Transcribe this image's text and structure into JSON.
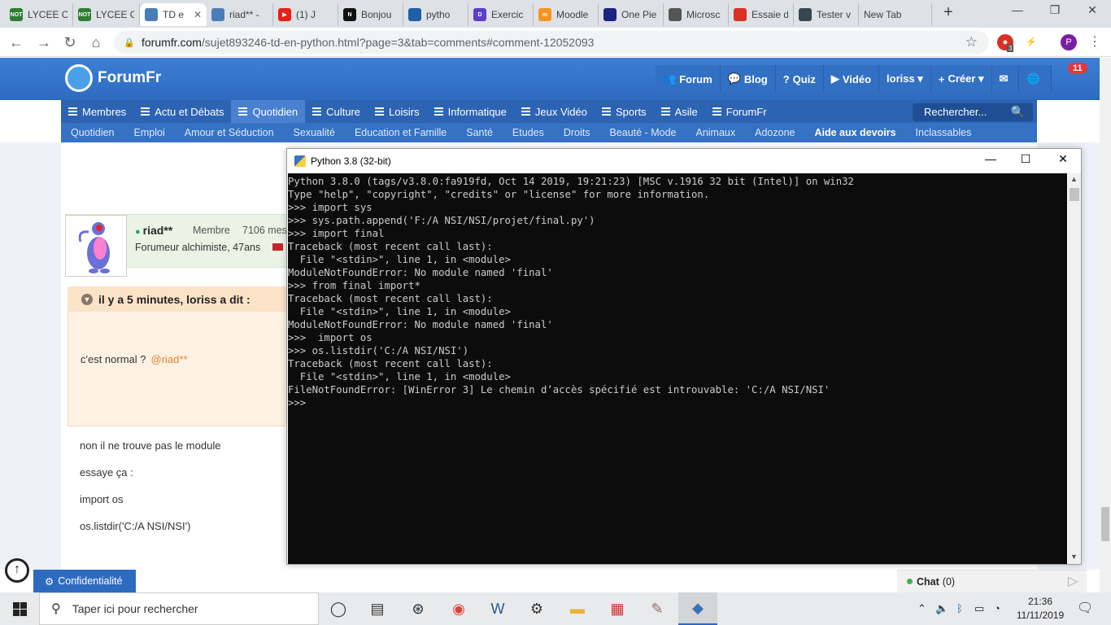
{
  "browser": {
    "tabs": [
      {
        "label": "LYCEE C",
        "color": "#2e7d32",
        "fav": "NOT"
      },
      {
        "label": "LYCEE G",
        "color": "#2e7d32",
        "fav": "NOT"
      },
      {
        "label": "TD e",
        "color": "#4a7db8",
        "fav": "",
        "active": true
      },
      {
        "label": "riad** -",
        "color": "#4a7db8",
        "fav": ""
      },
      {
        "label": "(1) J",
        "color": "#e62117",
        "fav": "▶"
      },
      {
        "label": "Bonjou",
        "color": "#111111",
        "fav": "N"
      },
      {
        "label": "pytho",
        "color": "#1f5fa6",
        "fav": ""
      },
      {
        "label": "Exercic",
        "color": "#5c3fc9",
        "fav": "D"
      },
      {
        "label": "Moodle",
        "color": "#f7931e",
        "fav": "m"
      },
      {
        "label": "One Pie",
        "color": "#1a237e",
        "fav": ""
      },
      {
        "label": "Microsc",
        "color": "#555555",
        "fav": ""
      },
      {
        "label": "Essaie d",
        "color": "#d93025",
        "fav": ""
      },
      {
        "label": "Tester v",
        "color": "#37474f",
        "fav": ""
      },
      {
        "label": "New Tab",
        "color": "",
        "fav": ""
      }
    ],
    "url_host": "forumfr.com",
    "url_path": "/sujet893246-td-en-python.html?page=3&tab=comments#comment-12052093",
    "ext_badge": "3",
    "profile_initial": "P"
  },
  "site": {
    "logo": "ForumFr",
    "topnav": [
      {
        "icon": "👥",
        "label": "Forum"
      },
      {
        "icon": "💬",
        "label": "Blog"
      },
      {
        "icon": "?",
        "label": "Quiz"
      },
      {
        "icon": "▶",
        "label": "Vidéo"
      },
      {
        "icon": "",
        "label": "loriss ▾"
      },
      {
        "icon": "+",
        "label": "Créer ▾"
      },
      {
        "icon": "✉",
        "label": ""
      },
      {
        "icon": "🌐",
        "label": ""
      }
    ],
    "notif_count": "11",
    "categories": [
      {
        "label": "Membres"
      },
      {
        "label": "Actu et Débats"
      },
      {
        "label": "Quotidien",
        "active": true
      },
      {
        "label": "Culture"
      },
      {
        "label": "Loisirs"
      },
      {
        "label": "Informatique"
      },
      {
        "label": "Jeux Vidéo"
      },
      {
        "label": "Sports"
      },
      {
        "label": "Asile"
      },
      {
        "label": "ForumFr"
      }
    ],
    "search_placeholder": "Rechercher...",
    "subcategories": [
      {
        "label": "Quotidien"
      },
      {
        "label": "Emploi"
      },
      {
        "label": "Amour et Séduction"
      },
      {
        "label": "Sexualité"
      },
      {
        "label": "Education et Famille"
      },
      {
        "label": "Santé"
      },
      {
        "label": "Etudes"
      },
      {
        "label": "Droits"
      },
      {
        "label": "Beauté - Mode"
      },
      {
        "label": "Animaux"
      },
      {
        "label": "Adozone"
      },
      {
        "label": "Aide aux devoirs",
        "strong": true
      },
      {
        "label": "Inclassables"
      }
    ]
  },
  "post": {
    "username": "riad**",
    "role": "Membre",
    "message_count": "7106 messages",
    "description": "Forumeur alchimiste, 47ans",
    "quote_title": "il y a 5 minutes, loriss a dit :",
    "quote_text": "c'est normal ?",
    "quote_mention": "@riad**",
    "lines": [
      "non il ne trouve pas le module",
      "essaye ça :",
      "import os",
      "os.listdir('C:/A  NSI/NSI')"
    ]
  },
  "python_window": {
    "title": "Python 3.8 (32-bit)",
    "lines": [
      "Python 3.8.0 (tags/v3.8.0:fa919fd, Oct 14 2019, 19:21:23) [MSC v.1916 32 bit (Intel)] on win32",
      "Type \"help\", \"copyright\", \"credits\" or \"license\" for more information.",
      ">>> import sys",
      ">>> sys.path.append('F:/A NSI/NSI/projet/final.py')",
      ">>> import final",
      "Traceback (most recent call last):",
      "  File \"<stdin>\", line 1, in <module>",
      "ModuleNotFoundError: No module named 'final'",
      ">>> from final import*",
      "Traceback (most recent call last):",
      "  File \"<stdin>\", line 1, in <module>",
      "ModuleNotFoundError: No module named 'final'",
      ">>>  import os",
      ">>> os.listdir('C:/A NSI/NSI')",
      "Traceback (most recent call last):",
      "  File \"<stdin>\", line 1, in <module>",
      "FileNotFoundError: [WinError 3] Le chemin d’accès spécifié est introuvable: 'C:/A NSI/NSI'",
      ">>>"
    ]
  },
  "footer": {
    "privacy": "Confidentialité",
    "chat_label": "Chat",
    "chat_count": "(0)"
  },
  "taskbar": {
    "search_placeholder": "Taper ici pour rechercher",
    "time": "21:36",
    "date": "11/11/2019"
  }
}
